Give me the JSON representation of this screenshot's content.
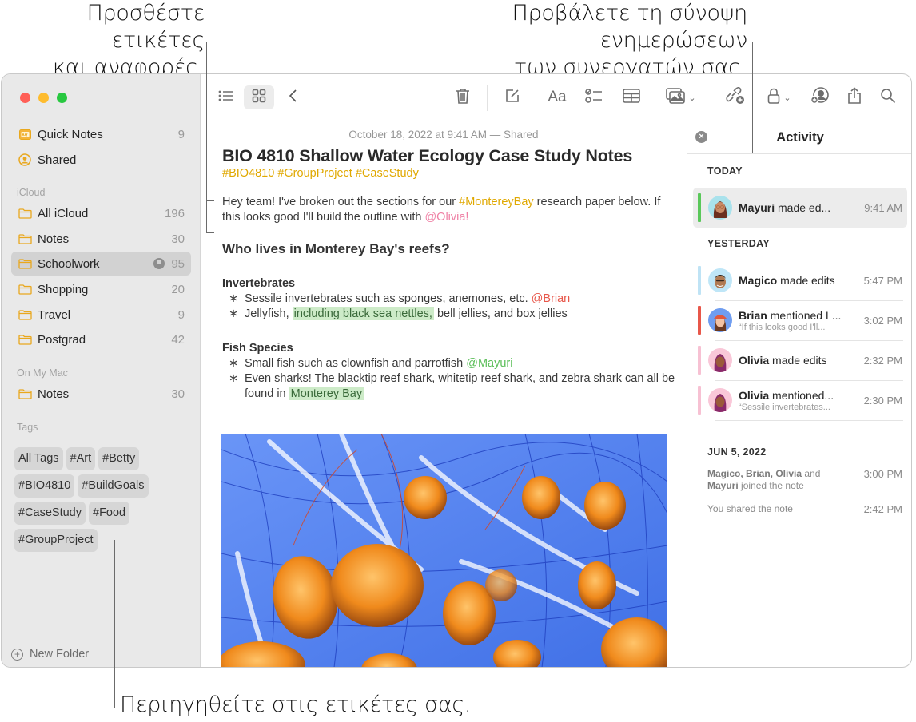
{
  "callouts": {
    "top_left": [
      "Προσθέστε ετικέτες",
      "και αναφορές."
    ],
    "top_right": [
      "Προβάλετε τη σύνοψη ενημερώσεων",
      "των συνεργατών σας."
    ],
    "bottom": "Περιηγηθείτε στις ετικέτες σας."
  },
  "sidebar": {
    "pinned": [
      {
        "label": "Quick Notes",
        "count": "9",
        "icon": "quick-notes-icon"
      },
      {
        "label": "Shared",
        "count": "",
        "icon": "shared-icon"
      }
    ],
    "icloud_header": "iCloud",
    "icloud": [
      {
        "label": "All iCloud",
        "count": "196"
      },
      {
        "label": "Notes",
        "count": "30"
      },
      {
        "label": "Schoolwork",
        "count": "95",
        "selected": true,
        "shared": true
      },
      {
        "label": "Shopping",
        "count": "20"
      },
      {
        "label": "Travel",
        "count": "9"
      },
      {
        "label": "Postgrad",
        "count": "42"
      }
    ],
    "mac_header": "On My Mac",
    "mac": [
      {
        "label": "Notes",
        "count": "30"
      }
    ],
    "tags_header": "Tags",
    "tags": [
      "All Tags",
      "#Art",
      "#Betty",
      "#BIO4810",
      "#BuildGoals",
      "#CaseStudy",
      "#Food",
      "#GroupProject"
    ],
    "new_folder": "New Folder"
  },
  "toolbar": {
    "font_label": "Aa",
    "icons": [
      "list-view-icon",
      "gallery-view-icon",
      "back-icon",
      "trash-icon",
      "compose-icon",
      "format-icon",
      "checklist-icon",
      "table-icon",
      "media-icon",
      "collaborate-link-icon",
      "lock-icon",
      "share-person-icon",
      "share-icon",
      "search-icon"
    ]
  },
  "note": {
    "date": "October 18, 2022 at 9:41 AM — Shared",
    "title": "BIO 4810 Shallow Water Ecology Case Study Notes",
    "tags": "#BIO4810 #GroupProject #CaseStudy",
    "intro": {
      "a": "Hey team! I've broken out the sections for our ",
      "hashtag": "#MontereyBay",
      "b": " research paper below. If this looks good I'll build the outline with ",
      "mention": "@Olivia!"
    },
    "heading": "Who lives in Monterey Bay's reefs?",
    "invertebrates": {
      "heading": "Invertebrates",
      "item1": {
        "text": "Sessile invertebrates such as sponges, anemones, etc. ",
        "mention": "@Brian"
      },
      "item2": {
        "a": "Jellyfish, ",
        "highlight": "including black sea nettles,",
        "b": " bell jellies, and box jellies"
      }
    },
    "fish": {
      "heading": "Fish Species",
      "item1": {
        "text": "Small fish such as clownfish and parrotfish ",
        "mention": "@Mayuri"
      },
      "item2": {
        "a": "Even sharks! The blacktip reef shark, whitetip reef shark, and zebra shark can all be found in ",
        "highlight": "Monterey Bay"
      }
    },
    "image_alt": "Jellyfish photo"
  },
  "activity": {
    "title": "Activity",
    "today_label": "TODAY",
    "yesterday_label": "YESTERDAY",
    "jun_label": "JUN 5, 2022",
    "today": [
      {
        "name": "Mayuri",
        "action": " made ed...",
        "sub": "",
        "time": "9:41 AM",
        "color": "#5ac85a"
      }
    ],
    "yesterday": [
      {
        "name": "Magico",
        "action": " made edits",
        "sub": "",
        "time": "5:47 PM",
        "color": "#bfe3f5"
      },
      {
        "name": "Brian",
        "action": " mentioned L...",
        "sub": "“If this looks good I'll...",
        "time": "3:02 PM",
        "color": "#e8574a"
      },
      {
        "name": "Olivia",
        "action": " made edits",
        "sub": "",
        "time": "2:32 PM",
        "color": "#f7c1d3"
      },
      {
        "name": "Olivia",
        "action": " mentioned...",
        "sub": "“Sessile invertebrates...",
        "time": "2:30 PM",
        "color": "#f7c1d3"
      }
    ],
    "jun": {
      "joined_names": "Magico, Brian, Olivia",
      "joined_and": " and ",
      "joined_last": "Mayuri",
      "joined_rest": " joined the note",
      "joined_time": "3:00 PM",
      "shared_text": "You shared the note",
      "shared_time": "2:42 PM"
    }
  },
  "colors": {
    "accent_folder": "#e9a81e",
    "hashtag": "#e0a800"
  }
}
